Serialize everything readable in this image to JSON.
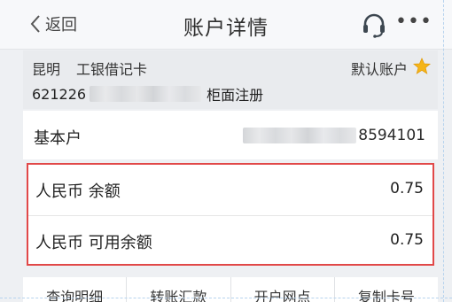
{
  "nav": {
    "back_label": "返回",
    "title": "账户详情",
    "more_label": "•••",
    "icons": {
      "back": "chevron-left-icon",
      "service": "headset-icon",
      "more": "more-dots-icon"
    }
  },
  "account": {
    "city": "昆明",
    "card_type": "工银借记卡",
    "default_label": "默认账户",
    "star_color": "#f5b518",
    "number_prefix": "621226",
    "reg_type": "柜面注册"
  },
  "basic": {
    "label": "基本户",
    "number_suffix": "8594101"
  },
  "balances": [
    {
      "label": "人民币 余额",
      "value": "0.75"
    },
    {
      "label": "人民币 可用余额",
      "value": "0.75"
    }
  ],
  "highlight_color": "#e14848",
  "tabs": [
    {
      "label": "查询明细"
    },
    {
      "label": "转账汇款"
    },
    {
      "label": "开户网点"
    },
    {
      "label": "复制卡号"
    }
  ]
}
